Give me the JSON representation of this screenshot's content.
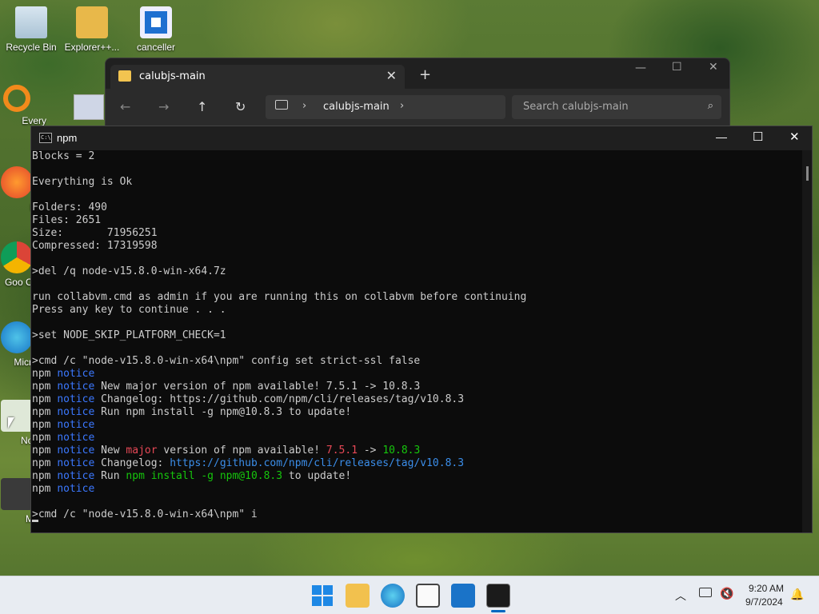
{
  "desktop": {
    "icons": [
      {
        "label": "Recycle Bin"
      },
      {
        "label": "Explorer++..."
      },
      {
        "label": "canceller"
      },
      {
        "label": "Every"
      },
      {
        "label": "Fire"
      },
      {
        "label": "Goo Chro"
      },
      {
        "label": "Micr Ed"
      },
      {
        "label": "Notep"
      },
      {
        "label": "MyM"
      }
    ]
  },
  "explorer": {
    "tab_title": "calubjs-main",
    "address_segment": "calubjs-main",
    "search_placeholder": "Search calubjs-main"
  },
  "terminal": {
    "title": "npm",
    "lines": [
      [
        {
          "t": "Blocks = 2"
        }
      ],
      [
        {
          "t": ""
        }
      ],
      [
        {
          "t": "Everything is Ok"
        }
      ],
      [
        {
          "t": ""
        }
      ],
      [
        {
          "t": "Folders: 490"
        }
      ],
      [
        {
          "t": "Files: 2651"
        }
      ],
      [
        {
          "t": "Size:       71956251"
        }
      ],
      [
        {
          "t": "Compressed: 17319598"
        }
      ],
      [
        {
          "t": ""
        }
      ],
      [
        {
          "t": ">del /q node-v15.8.0-win-x64.7z"
        }
      ],
      [
        {
          "t": ""
        }
      ],
      [
        {
          "t": "run collabvm.cmd as admin if you are running this on collabvm before continuing"
        }
      ],
      [
        {
          "t": "Press any key to continue . . ."
        }
      ],
      [
        {
          "t": ""
        }
      ],
      [
        {
          "t": ">set NODE_SKIP_PLATFORM_CHECK=1"
        }
      ],
      [
        {
          "t": ""
        }
      ],
      [
        {
          "t": ">cmd /c \"node-v15.8.0-win-x64\\npm\" config set strict-ssl false"
        }
      ],
      [
        {
          "t": "npm "
        },
        {
          "t": "notice",
          "c": "c-blue"
        }
      ],
      [
        {
          "t": "npm "
        },
        {
          "t": "notice",
          "c": "c-blue"
        },
        {
          "t": " New major version of npm available! 7.5.1 -> 10.8.3"
        }
      ],
      [
        {
          "t": "npm "
        },
        {
          "t": "notice",
          "c": "c-blue"
        },
        {
          "t": " Changelog: https://github.com/npm/cli/releases/tag/v10.8.3"
        }
      ],
      [
        {
          "t": "npm "
        },
        {
          "t": "notice",
          "c": "c-blue"
        },
        {
          "t": " Run npm install -g npm@10.8.3 to update!"
        }
      ],
      [
        {
          "t": "npm "
        },
        {
          "t": "notice",
          "c": "c-blue"
        }
      ],
      [
        {
          "t": "npm "
        },
        {
          "t": "notice",
          "c": "c-blue"
        }
      ],
      [
        {
          "t": "npm "
        },
        {
          "t": "notice",
          "c": "c-blue"
        },
        {
          "t": " New "
        },
        {
          "t": "major",
          "c": "c-red"
        },
        {
          "t": " version of npm available! "
        },
        {
          "t": "7.5.1",
          "c": "c-red"
        },
        {
          "t": " -> "
        },
        {
          "t": "10.8.3",
          "c": "c-green"
        }
      ],
      [
        {
          "t": "npm "
        },
        {
          "t": "notice",
          "c": "c-blue"
        },
        {
          "t": " Changelog: "
        },
        {
          "t": "https://github.com/npm/cli/releases/tag/v10.8.3",
          "c": "c-lblue"
        }
      ],
      [
        {
          "t": "npm "
        },
        {
          "t": "notice",
          "c": "c-blue"
        },
        {
          "t": " Run "
        },
        {
          "t": "npm install -g npm@10.8.3",
          "c": "c-green"
        },
        {
          "t": " to update!"
        }
      ],
      [
        {
          "t": "npm "
        },
        {
          "t": "notice",
          "c": "c-blue"
        }
      ],
      [
        {
          "t": ""
        }
      ],
      [
        {
          "t": ">cmd /c \"node-v15.8.0-win-x64\\npm\" i"
        }
      ]
    ]
  },
  "taskbar": {
    "time": "9:20 AM",
    "date": "9/7/2024"
  },
  "icons": {
    "minimize": "minimize-icon",
    "maximize": "maximize-icon",
    "close": "close-icon"
  },
  "colors": {
    "terminal_bg": "#0c0c0c",
    "notice_blue": "#3b78ff",
    "major_red": "#e74856",
    "version_green": "#16c60c"
  }
}
